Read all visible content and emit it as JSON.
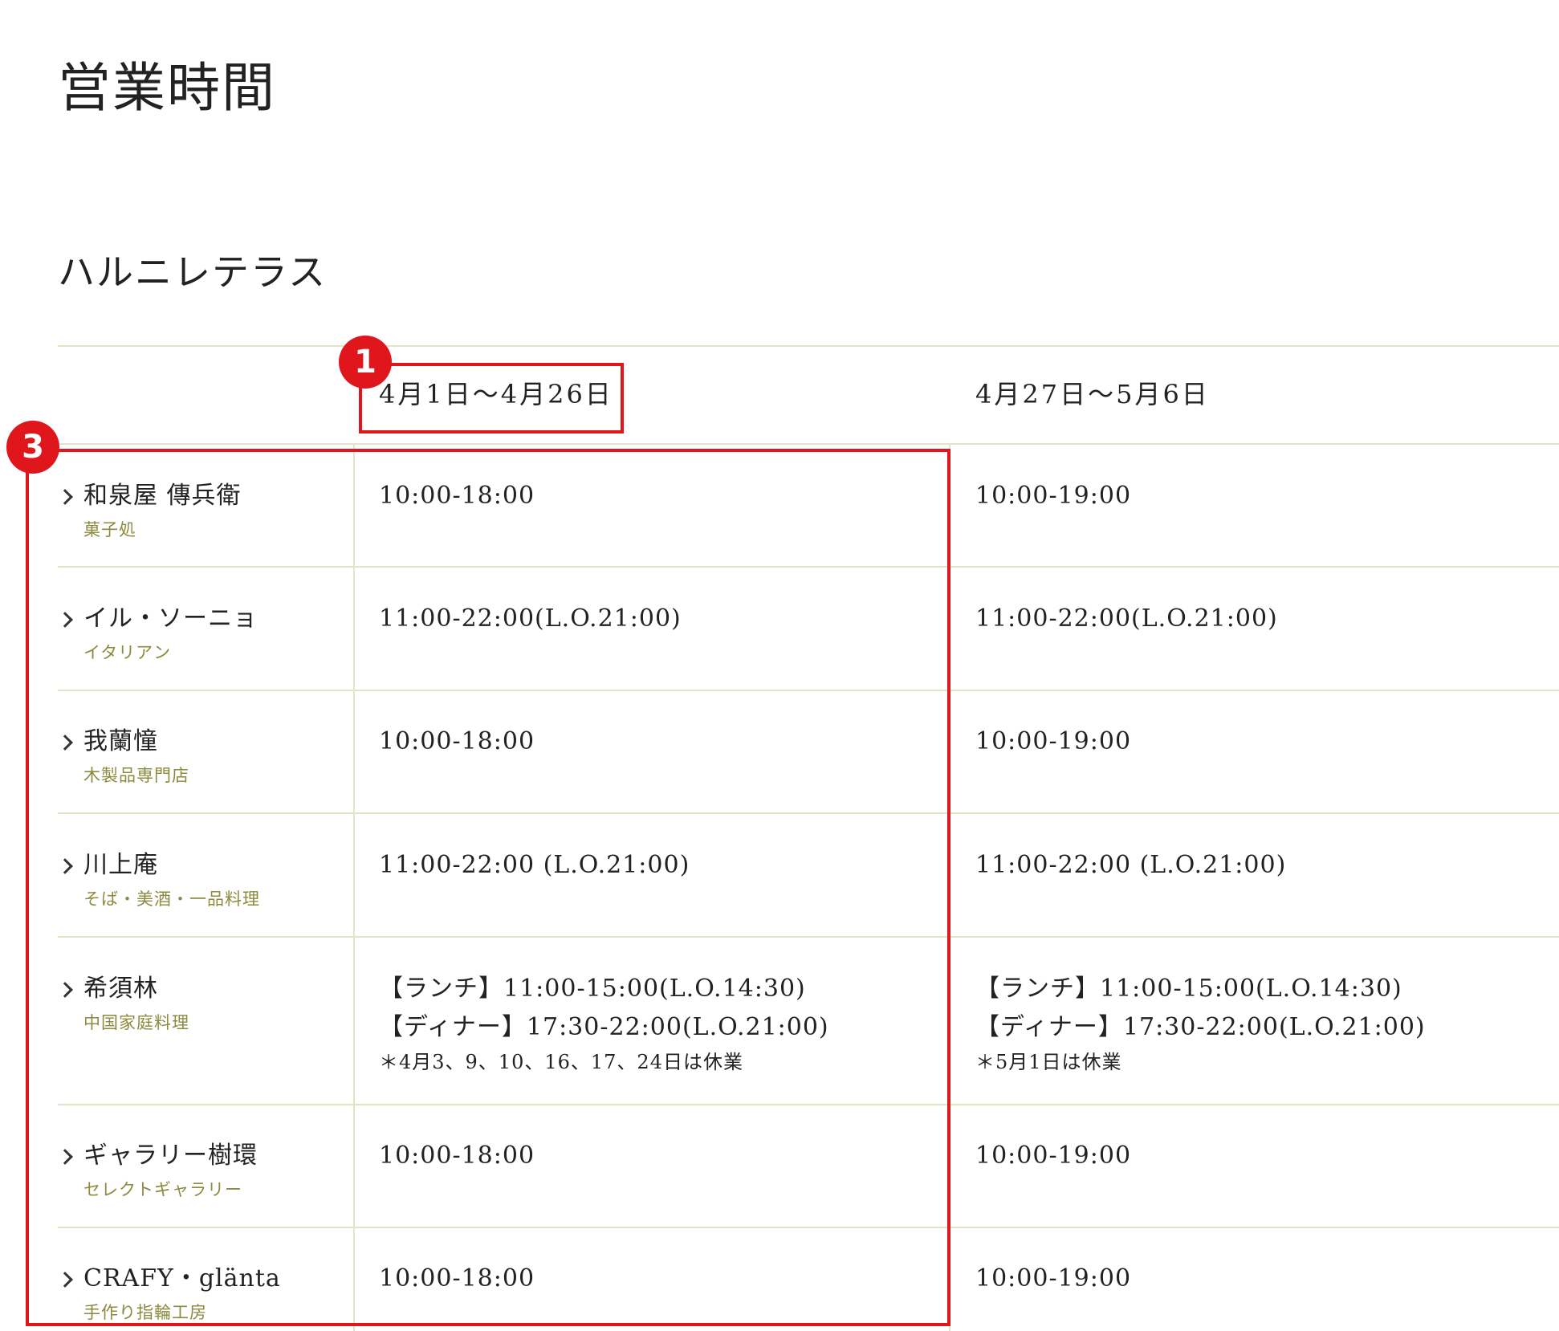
{
  "page_title": "営業時間",
  "section_title": "ハルニレテラス",
  "columns": [
    "4月1日～4月26日",
    "4月27日～5月6日"
  ],
  "rows": [
    {
      "name": "和泉屋 傳兵衛",
      "category": "菓子処",
      "period1": {
        "line1": "10:00-18:00"
      },
      "period2": {
        "line1": "10:00-19:00"
      }
    },
    {
      "name": "イル・ソーニョ",
      "category": "イタリアン",
      "period1": {
        "line1": "11:00-22:00(L.O.21:00)"
      },
      "period2": {
        "line1": "11:00-22:00(L.O.21:00)"
      }
    },
    {
      "name": "我蘭憧",
      "category": "木製品専門店",
      "period1": {
        "line1": "10:00-18:00"
      },
      "period2": {
        "line1": "10:00-19:00"
      }
    },
    {
      "name": "川上庵",
      "category": "そば・美酒・一品料理",
      "period1": {
        "line1": "11:00-22:00 (L.O.21:00)"
      },
      "period2": {
        "line1": "11:00-22:00 (L.O.21:00)"
      }
    },
    {
      "name": "希須林",
      "category": "中国家庭料理",
      "period1": {
        "line1": "【ランチ】11:00-15:00(L.O.14:30)",
        "line2": "【ディナー】17:30-22:00(L.O.21:00)",
        "note": "＊4月3、9、10、16、17、24日は休業"
      },
      "period2": {
        "line1": "【ランチ】11:00-15:00(L.O.14:30)",
        "line2": "【ディナー】17:30-22:00(L.O.21:00)",
        "note": "＊5月1日は休業"
      }
    },
    {
      "name": "ギャラリー樹環",
      "category": "セレクトギャラリー",
      "period1": {
        "line1": "10:00-18:00"
      },
      "period2": {
        "line1": "10:00-19:00"
      }
    },
    {
      "name": "CRAFY・glänta",
      "category": "手作り指輪工房",
      "period1": {
        "line1": "10:00-18:00"
      },
      "period2": {
        "line1": "10:00-19:00"
      }
    }
  ],
  "annotations": {
    "badge1": "1",
    "badge3": "3",
    "color": "#e0161d"
  },
  "colors": {
    "divider": "#e2e4c8",
    "category_text": "#8c8a3e",
    "body_text": "#222222"
  }
}
